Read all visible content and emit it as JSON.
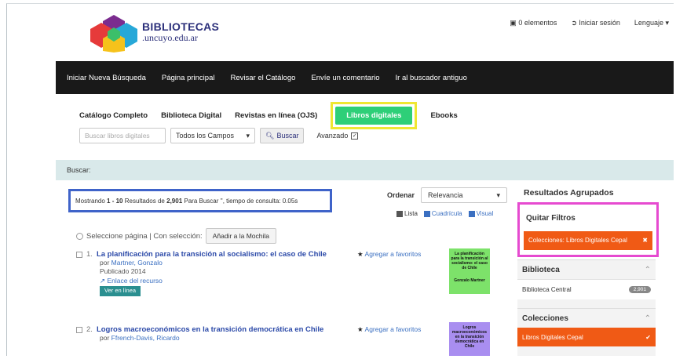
{
  "header": {
    "logo_line1": "BIBLIOTECAS",
    "logo_line2": ".uncuyo.edu.ar",
    "toplinks": [
      "0 elementos",
      "Iniciar sesión",
      "Lenguaje"
    ]
  },
  "navbar": [
    "Iniciar Nueva Búsqueda",
    "Página principal",
    "Revisar el Catálogo",
    "Envíe un comentario",
    "Ir al buscador antiguo"
  ],
  "tabs": {
    "items": [
      "Catálogo Completo",
      "Biblioteca Digital",
      "Revistas en línea (OJS)"
    ],
    "active": "Libros digitales",
    "after": "Ebooks",
    "active_color": "#2ecf78",
    "highlight_color": "#efe733"
  },
  "search": {
    "placeholder": "Buscar libros digitales",
    "field": "Todos los Campos",
    "button": "Buscar",
    "advanced": "Avanzado"
  },
  "buscar_bar": "Buscar:",
  "results": {
    "prefix": "Mostrando",
    "range": "1 - 10",
    "mid": "Resultados de",
    "total": "2,901",
    "suffix": "Para Buscar '', tiempo de consulta: 0.05s",
    "box_color": "#3f63c9"
  },
  "sort": {
    "label": "Ordenar",
    "value": "Relevancia",
    "views": [
      "Lista",
      "Cuadrícula",
      "Visual"
    ]
  },
  "selection": {
    "label": "Seleccione página | Con selección:",
    "button": "Añadir a la Mochila"
  },
  "items": [
    {
      "num": "1.",
      "title": "La planificación para la transición al socialismo: el caso de Chile",
      "author_prefix": "por",
      "author": "Martner, Gonzalo",
      "published": "Publicado 2014",
      "link": "Enlace del recurso",
      "button": "Ver en línea",
      "fav": "Agregar a favoritos",
      "cover_text": "La planificación para la transición al socialismo: el caso de Chile",
      "cover_author": "Gonzalo Martner",
      "cover_color": "#7de26a"
    },
    {
      "num": "2.",
      "title": "Logros macroeconómicos en la transición democrática en Chile",
      "author_prefix": "por",
      "author": "Ffrench-Davis, Ricardo",
      "fav": "Agregar a favoritos",
      "cover_text": "Logros macroeconómicos en la transición democrática en Chile",
      "cover_color": "#a98ef0"
    }
  ],
  "sidebar": {
    "title": "Resultados Agrupados",
    "quitar_title": "Quitar Filtros",
    "quitar_button": "Colecciones: Libros Digitales Cepal",
    "quitar_color": "#f05a15",
    "quitar_border": "#e64ad0",
    "biblioteca_title": "Biblioteca",
    "biblioteca_item": "Biblioteca Central",
    "biblioteca_count": "2,901",
    "colecciones_title": "Colecciones",
    "colecciones_item": "Libros Digitales Cepal"
  }
}
